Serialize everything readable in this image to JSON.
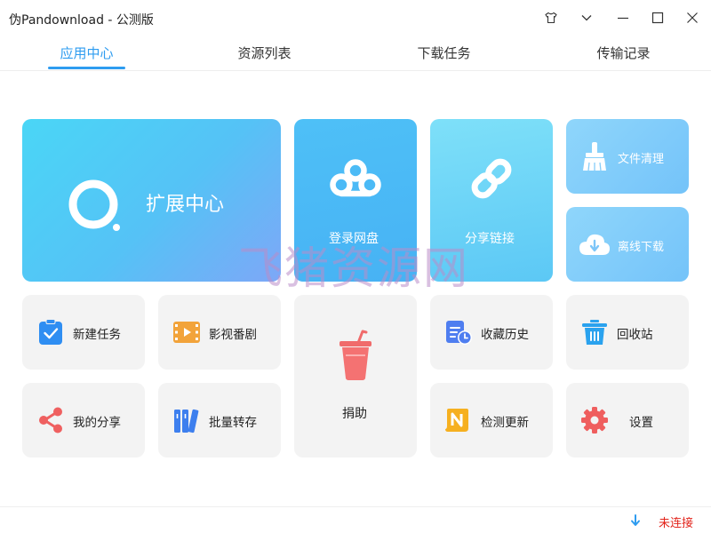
{
  "window": {
    "title": "伪Pandownload - 公测版",
    "controls": [
      "shirt-icon",
      "chevron-down-icon",
      "minimize-icon",
      "maximize-icon",
      "close-icon"
    ]
  },
  "tabs": [
    {
      "label": "应用中心",
      "active": true
    },
    {
      "label": "资源列表",
      "active": false
    },
    {
      "label": "下载任务",
      "active": false
    },
    {
      "label": "传输记录",
      "active": false
    }
  ],
  "feature_cards": {
    "extension": {
      "label": "扩展中心",
      "icon": "extension-ring-icon"
    },
    "login": {
      "label": "登录网盘",
      "icon": "baidu-cloud-icon"
    },
    "share_link": {
      "label": "分享链接",
      "icon": "link-icon"
    },
    "file_clean": {
      "label": "文件清理",
      "icon": "broom-icon"
    },
    "offline_download": {
      "label": "离线下载",
      "icon": "cloud-download-icon"
    }
  },
  "tiles": {
    "new_task": {
      "label": "新建任务",
      "icon": "clipboard-check-icon"
    },
    "video": {
      "label": "影视番剧",
      "icon": "film-icon"
    },
    "donate": {
      "label": "捐助",
      "icon": "cup-icon"
    },
    "history": {
      "label": "收藏历史",
      "icon": "history-icon"
    },
    "recycle": {
      "label": "回收站",
      "icon": "trash-icon"
    },
    "my_share": {
      "label": "我的分享",
      "icon": "share-icon"
    },
    "batch_transfer": {
      "label": "批量转存",
      "icon": "books-icon"
    },
    "update_check": {
      "label": "检测更新",
      "icon": "n-logo-icon"
    },
    "settings": {
      "label": "设置",
      "icon": "gear-icon"
    }
  },
  "status": {
    "text": "未连接",
    "icon": "download-arrow-icon"
  },
  "watermark": "飞猪资源网",
  "colors": {
    "accent": "#2e9cf0",
    "status_error": "#e2231a",
    "card_gray": "#f3f3f3"
  }
}
